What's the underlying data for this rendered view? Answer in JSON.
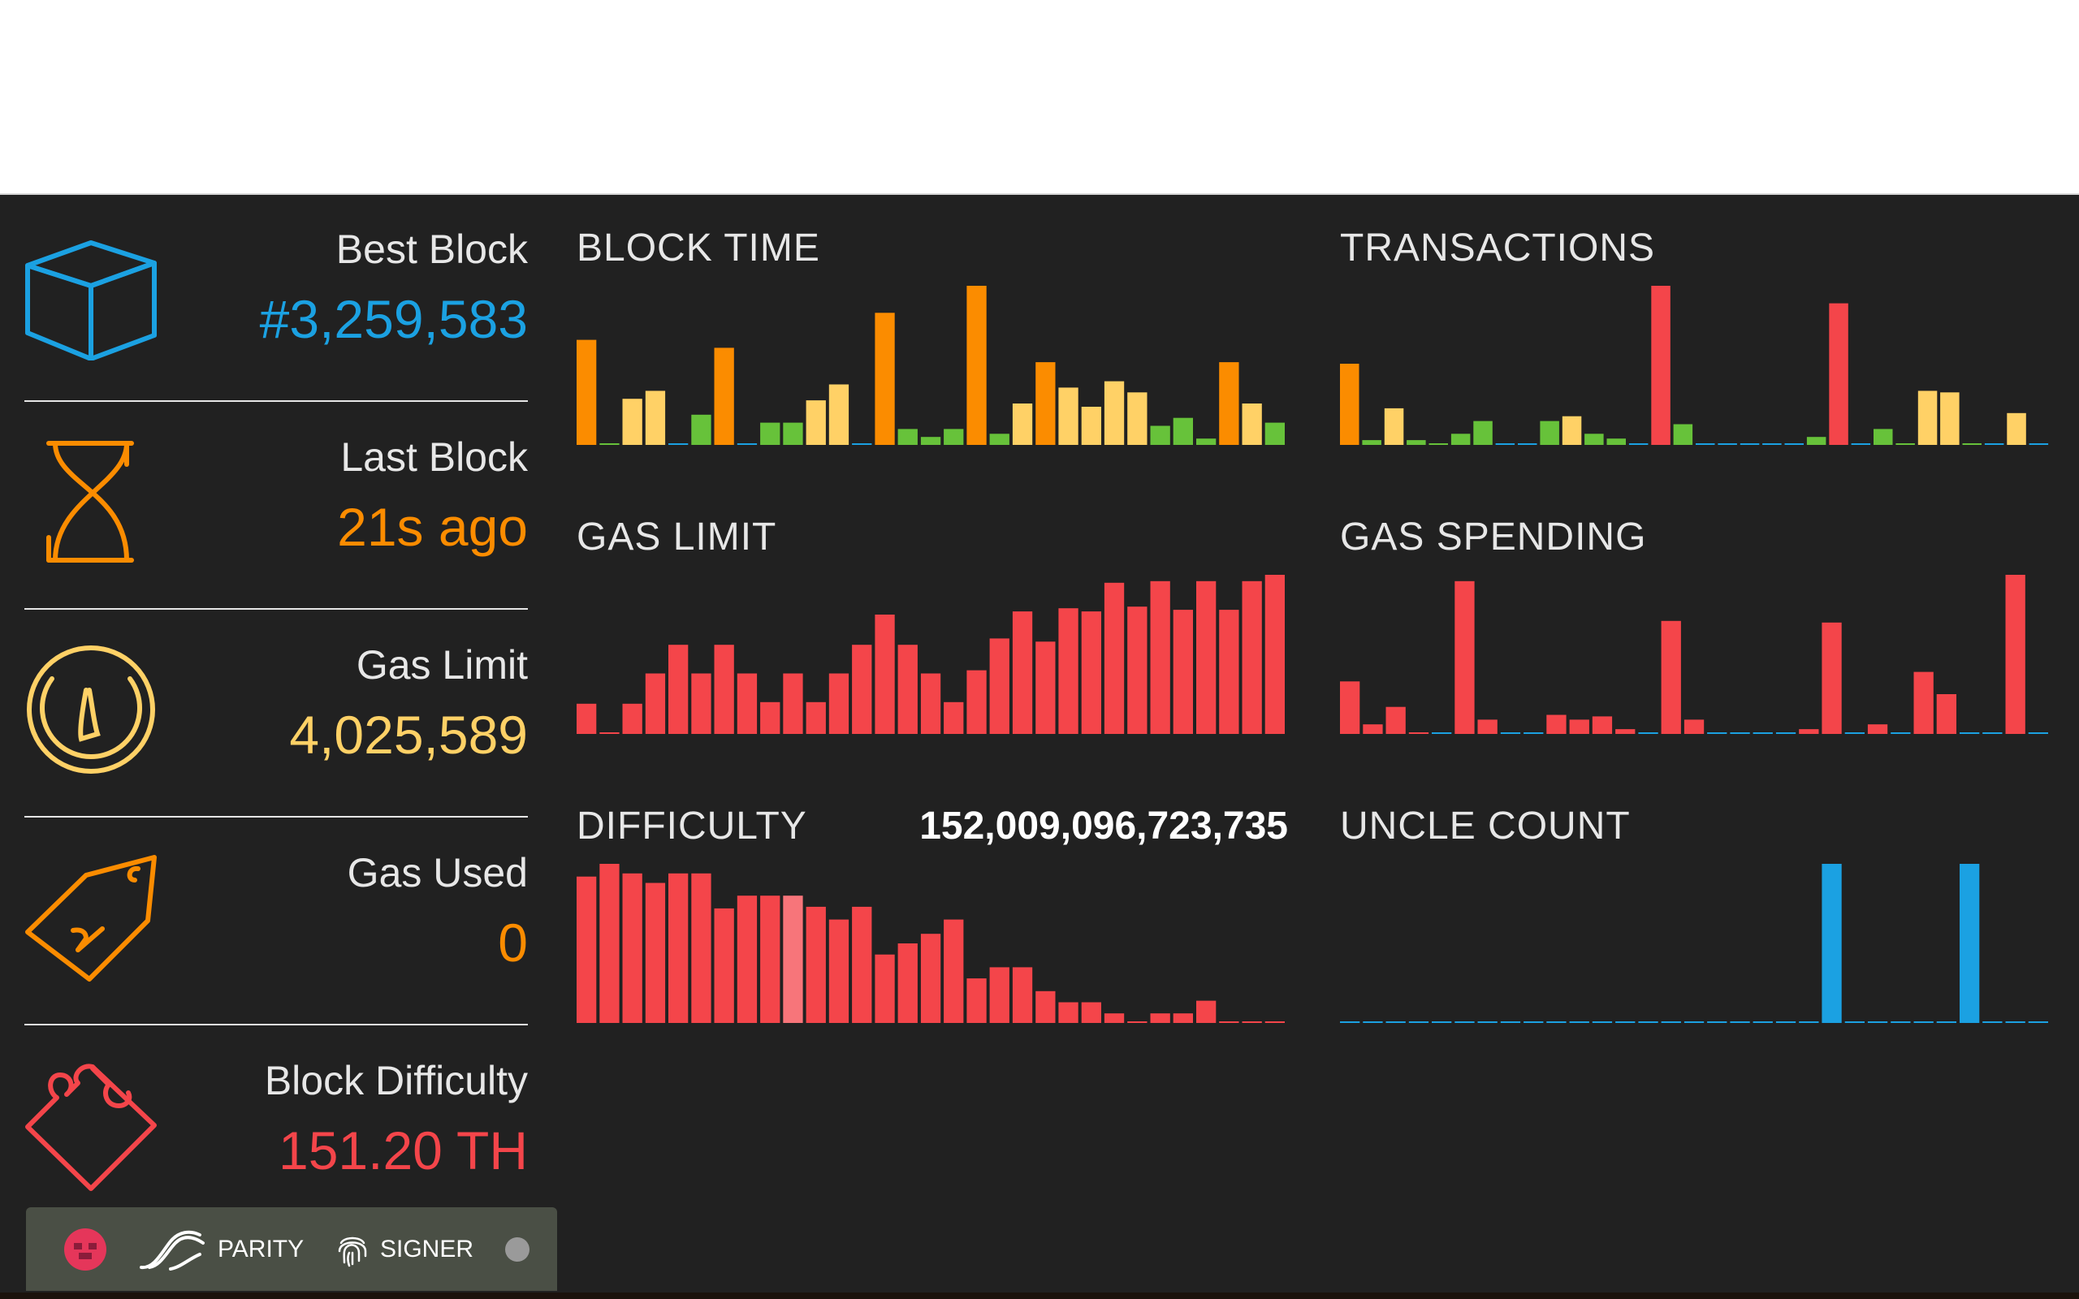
{
  "stats": [
    {
      "label": "Best Block",
      "value": "#3,259,583",
      "icon": "cube-icon",
      "color": "#1ba1e2"
    },
    {
      "label": "Last Block",
      "value": "21s ago",
      "icon": "hourglass-icon",
      "color": "#fb8c00"
    },
    {
      "label": "Gas Limit",
      "value": "4,025,589",
      "icon": "gauge-icon",
      "color": "#ffd166"
    },
    {
      "label": "Gas Used",
      "value": "0",
      "icon": "tag-icon",
      "color": "#fb8c00"
    },
    {
      "label": "Block Difficulty",
      "value": "151.20 TH",
      "icon": "puzzle-icon",
      "color": "#f4454a"
    }
  ],
  "palette": {
    "orange": "#fb8c00",
    "yellow": "#ffd166",
    "green": "#67c23a",
    "red": "#f4454a",
    "blue": "#1ba1e2"
  },
  "charts": [
    {
      "title": "BLOCK TIME",
      "extra": "",
      "values": [
        0.66,
        0.01,
        0.29,
        0.34,
        0,
        0.19,
        0.61,
        0,
        0.14,
        0.14,
        0.28,
        0.38,
        0,
        0.83,
        0.1,
        0.05,
        0.1,
        1.0,
        0.07,
        0.26,
        0.52,
        0.36,
        0.24,
        0.4,
        0.33,
        0.12,
        0.17,
        0.04,
        0.52,
        0.26,
        0.14
      ],
      "colors": [
        "orange",
        "green",
        "yellow",
        "yellow",
        "blue",
        "green",
        "orange",
        "blue",
        "green",
        "green",
        "yellow",
        "yellow",
        "blue",
        "orange",
        "green",
        "green",
        "green",
        "orange",
        "green",
        "yellow",
        "orange",
        "yellow",
        "yellow",
        "yellow",
        "yellow",
        "green",
        "green",
        "green",
        "orange",
        "yellow",
        "green"
      ]
    },
    {
      "title": "TRANSACTIONS",
      "extra": "",
      "values": [
        0.51,
        0.03,
        0.23,
        0.03,
        0.01,
        0.07,
        0.15,
        0,
        0,
        0.15,
        0.18,
        0.07,
        0.04,
        0,
        1.0,
        0.13,
        0,
        0,
        0,
        0,
        0,
        0.05,
        0.89,
        0,
        0.1,
        0.01,
        0.34,
        0.33,
        0,
        0,
        0.2,
        0
      ],
      "colors": [
        "orange",
        "green",
        "yellow",
        "green",
        "green",
        "green",
        "green",
        "blue",
        "blue",
        "green",
        "yellow",
        "green",
        "green",
        "blue",
        "red",
        "green",
        "blue",
        "blue",
        "blue",
        "blue",
        "blue",
        "green",
        "red",
        "blue",
        "green",
        "green",
        "yellow",
        "yellow",
        "green",
        "blue",
        "yellow",
        "blue"
      ]
    },
    {
      "title": "GAS LIMIT",
      "extra": "",
      "values": [
        0.19,
        0,
        0.19,
        0.38,
        0.56,
        0.38,
        0.56,
        0.38,
        0.2,
        0.38,
        0.2,
        0.38,
        0.56,
        0.75,
        0.56,
        0.38,
        0.2,
        0.4,
        0.6,
        0.77,
        0.58,
        0.79,
        0.77,
        0.95,
        0.8,
        0.96,
        0.78,
        0.96,
        0.78,
        0.96,
        1.0
      ],
      "colors": [
        "red"
      ]
    },
    {
      "title": "GAS SPENDING",
      "extra": "",
      "values": [
        0.33,
        0.06,
        0.17,
        0.01,
        0,
        0.96,
        0.09,
        0,
        0,
        0.12,
        0.09,
        0.11,
        0.03,
        0,
        0.71,
        0.09,
        0,
        0,
        0,
        0,
        0.03,
        0.7,
        0,
        0.06,
        0,
        0.39,
        0.25,
        0,
        0,
        1.0,
        0
      ],
      "colors": [
        "red",
        "red",
        "red",
        "red",
        "blue",
        "red",
        "red",
        "blue",
        "blue",
        "red",
        "red",
        "red",
        "red",
        "blue",
        "red",
        "red",
        "blue",
        "blue",
        "blue",
        "blue",
        "red",
        "red",
        "blue",
        "red",
        "blue",
        "red",
        "red",
        "blue",
        "blue",
        "red",
        "blue"
      ]
    },
    {
      "title": "DIFFICULTY",
      "extra": "152,009,096,723,735",
      "values": [
        0.92,
        1.0,
        0.94,
        0.88,
        0.94,
        0.94,
        0.72,
        0.8,
        0.8,
        0.8,
        0.73,
        0.65,
        0.73,
        0.43,
        0.5,
        0.56,
        0.65,
        0.28,
        0.35,
        0.35,
        0.2,
        0.13,
        0.13,
        0.06,
        0.01,
        0.06,
        0.06,
        0.14,
        0.01,
        0.01,
        0.01
      ],
      "colors": [
        "red",
        "red",
        "red",
        "red",
        "red",
        "red",
        "red",
        "red",
        "red",
        "pink",
        "red",
        "red",
        "red",
        "red",
        "red",
        "red",
        "red",
        "red",
        "red",
        "red",
        "red",
        "red",
        "red",
        "red",
        "red",
        "red",
        "red",
        "red",
        "red",
        "red",
        "red"
      ]
    },
    {
      "title": "UNCLE COUNT",
      "extra": "",
      "values": [
        0,
        0,
        0,
        0,
        0,
        0,
        0,
        0,
        0,
        0,
        0,
        0,
        0,
        0,
        0,
        0,
        0,
        0,
        0,
        0,
        0,
        1,
        0,
        0,
        0,
        0,
        0,
        1,
        0,
        0,
        0
      ],
      "colors": [
        "blue"
      ]
    }
  ],
  "footer": {
    "parity": "PARITY",
    "signer": "SIGNER"
  }
}
